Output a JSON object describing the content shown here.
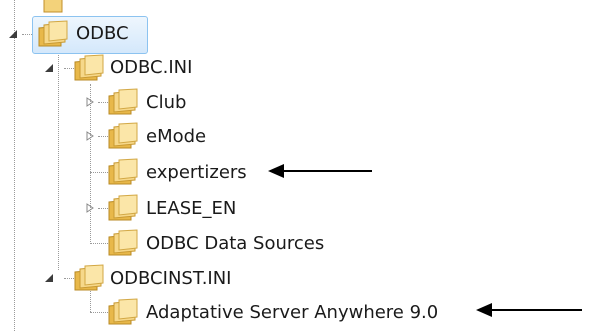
{
  "tree": {
    "root": {
      "label": "ODBC",
      "expanded": true,
      "selected": true
    },
    "nodes": [
      {
        "label": "ODBC.INI",
        "expanded": true
      },
      {
        "label": "Club",
        "expander": "collapsed"
      },
      {
        "label": "eMode",
        "expander": "collapsed"
      },
      {
        "label": "expertizers",
        "expander": "none",
        "marked": true
      },
      {
        "label": "LEASE_EN",
        "expander": "collapsed"
      },
      {
        "label": "ODBC Data Sources",
        "expander": "none"
      },
      {
        "label": "ODBCINST.INI",
        "expanded": true
      },
      {
        "label": "Adaptative Server Anywhere 9.0",
        "expander": "none",
        "marked": true
      }
    ]
  },
  "colors": {
    "selection_border": "#8cc3f0",
    "selection_fill": "#d4e8fb",
    "folder": "#e8b84a",
    "tree_lines": "#9a9a9a",
    "annotation_arrow": "#000000"
  },
  "icons": {
    "folder": "folder-icon",
    "expanded": "expanded-triangle-icon",
    "collapsed": "collapsed-triangle-icon",
    "annotation": "arrow-left-icon"
  }
}
